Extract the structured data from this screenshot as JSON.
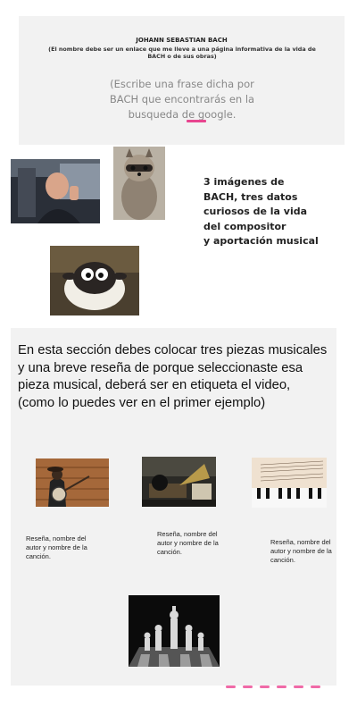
{
  "header": {
    "title": "JOHANN SEBASTIAN BACH",
    "subtitle": "(El nombre debe ser un enlace que me lleve a una página informativa de la vida de BACH o de sus obras)",
    "quote_prompt": "(Escribe una frase dicha por BACH que encontrarás en la busqueda de google."
  },
  "facts": {
    "text_line1": "3 imágenes de",
    "text_line2": "BACH, tres datos",
    "text_line3": "curiosos de la vida",
    "text_line4": "del compositor",
    "text_line5": "y aportación musical"
  },
  "section": {
    "instructions": "En esta sección debes colocar tres piezas musicales y una breve reseña de porque seleccionaste esa pieza musical, deberá ser en etiqueta el video, (como lo puedes ver en el primer ejemplo)",
    "reviews": [
      "Reseña, nombre del autor y nombre de la canción.",
      "Reseña, nombre del autor y nombre de la canción.",
      "Reseña, nombre del autor y nombre de la canción."
    ]
  },
  "colors": {
    "accent_pink": "#e8458f",
    "panel_gray": "#f2f2f2"
  }
}
